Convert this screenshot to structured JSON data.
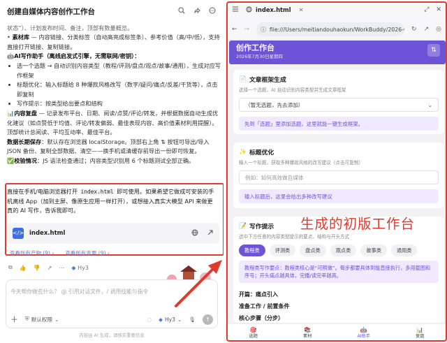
{
  "left": {
    "title": "创建自媒体内容创作工作台",
    "line_top": "• 选题看板 — 标题、来源、创作状态（待创作/创作中/已完成/已发布，可一键“推进状态”）、计划发布时间、备注，顶部有数量概览。",
    "line_material_label": "素材库",
    "line_material": " — 内容链接、分类标签（自动高亮成标签条）、参考价值（高/中/低），支持直接打开链接、复制链接。",
    "ai_heading": "AI写作助手（离线启发式引擎，无需联网/密钥）：",
    "ai_bullets": [
      "选一个选题 → 自动识别内容类型（教程/评测/盘点/观点/故事/通用），生成对应写作框架",
      "标题优化：输入标题给 8 种爆款风格改写（数字/疑问/痛点/反差/干货等），点击即复制",
      "写作提示：按类型给出要点和结构"
    ],
    "review_label": "内容复盘",
    "review_text": " — 记录发布平台、日期、阅读/点赞/评论/转发，并根据数据自动生成优化建议（如点赞低于均值、评论/转发偏弱、最佳表现内容、高价值素材利用提醒）。顶部统计总阅读、平均互动率、最佳平台。",
    "storage_label": "数据长期保存",
    "storage_text": "：默认存在浏览器 localStorage。顶部右上角 ⇅ 按钮可导出/导入 JSON 备份、复制全部数据、清空——换手机或清缓存前导出一份即可恢复。",
    "verify_label": "校验情况",
    "verify_text": "：JS 语法检查通过；内容类型识别用 6 个标题测试全部正确。",
    "highlight_pre": "直接在手机/电脑浏览器打开 ",
    "highlight_code": "index.html",
    "highlight_post": " 即可使用。如果希望它做成可安装的手机离线 App（加到主屏、像原生应用一样打开），或想接入真实大模型 API 来做更真的 AI 写作，告诉我即可。",
    "file_name": "index.html",
    "link_1": "查看所有产物 (9) ›",
    "link_2": "查看所有变更 (9) ›",
    "model_name": "Hy3",
    "input_placeholder": "今天帮你做些什么？ @ 引用对话文件，/ 调用技能与指令",
    "permission_label": "默认权限",
    "footnote": "内容由 AI 生成，请核实重要信息"
  },
  "browser": {
    "tab_title": "index.html",
    "url": "file:///Users/meitiandouhaokun/WorkBuddy/2026-07-30-12",
    "app_title": "创作工作台",
    "app_date": "2026年7月30日星期四"
  },
  "cards": {
    "framework": {
      "title": "文章框架生成",
      "desc": "选择一个选题，AI 自动识别内容类型并生成文章框架",
      "select_value": "（暂无选题，先去添加）",
      "tip": "先到「选题」里添加选题，这里就能一键生成框架。"
    },
    "title_opt": {
      "title": "标题优化",
      "desc": "输入一个标题，获取多种爆款风格的改写建议（点击可复制）",
      "placeholder": "例如：如何高效做自媒体",
      "tip": "输入标题后，这里会给出多种改写建议"
    },
    "writing": {
      "title": "写作提示",
      "desc": "选中下方任意的内容类型提示的要点、结构与开头方式",
      "chips": [
        "教程类",
        "评测类",
        "盘点类",
        "观点类",
        "故事类",
        "通用类"
      ],
      "active_chip": "教程类",
      "bigtip": "教程类写作要点：教程类核心是“可照做”。每步都要具体到能直接执行，多用截图和序号；开头痛点越具体，完播/读完率越高。",
      "outline": [
        "开篇：痛点引入",
        "准备工作 / 前置条件",
        "核心步骤（分步）"
      ]
    }
  },
  "overlay_text": "生成的初版工作台",
  "bottom_nav": [
    {
      "label": "选题",
      "icon": "target-icon"
    },
    {
      "label": "素材",
      "icon": "books-icon"
    },
    {
      "label": "AI助手",
      "icon": "robot-icon"
    },
    {
      "label": "复盘",
      "icon": "chart-icon"
    }
  ],
  "colors": {
    "accent": "#6b55d6",
    "annotation_red": "#e03a2e"
  }
}
